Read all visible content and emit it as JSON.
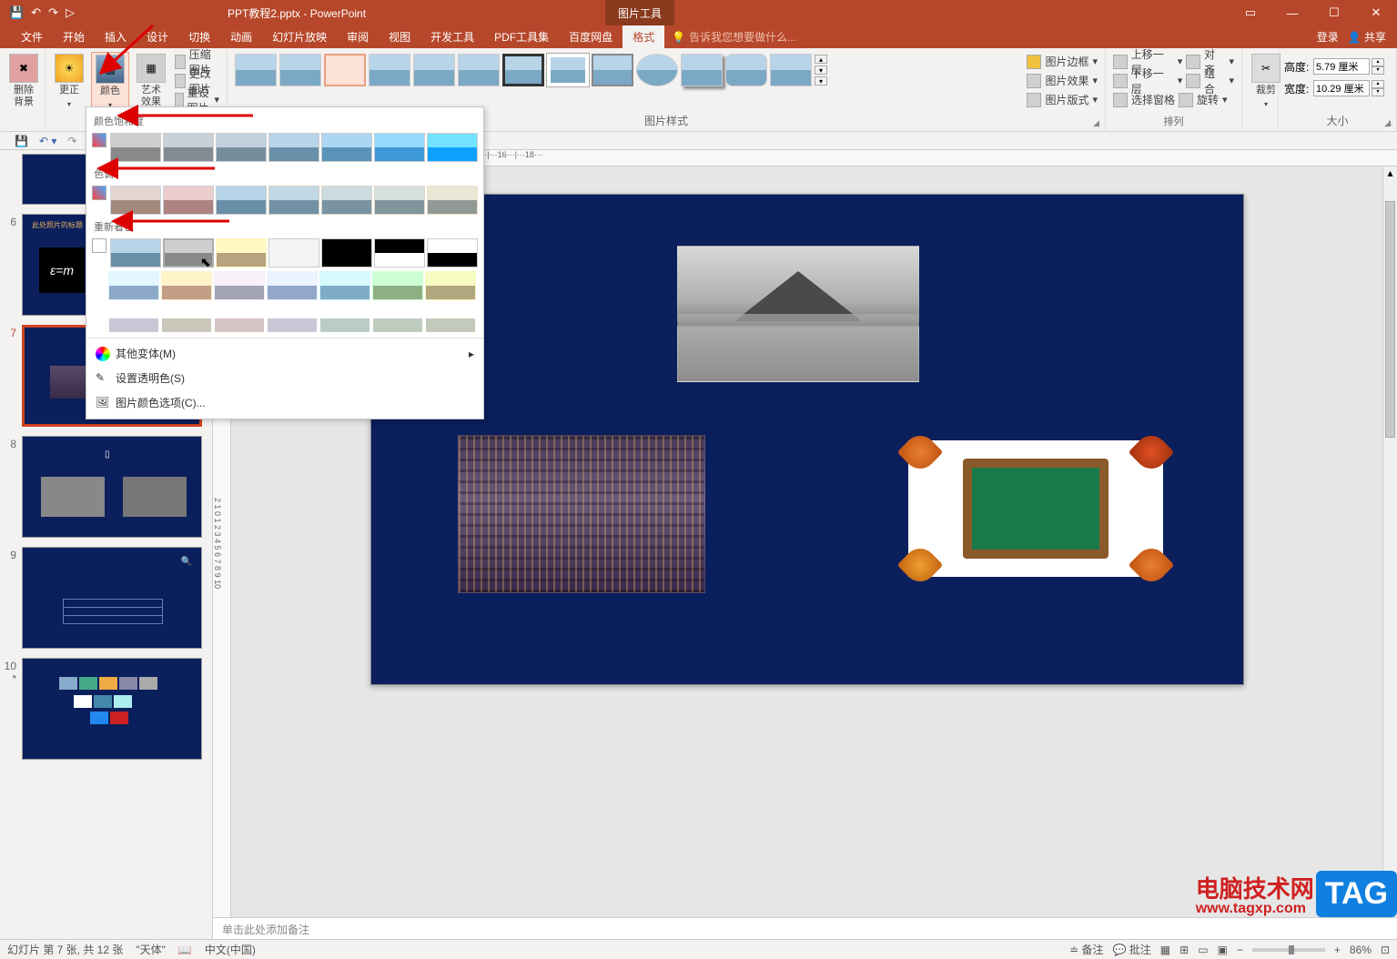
{
  "app": {
    "title": "PPT教程2.pptx - PowerPoint",
    "tooltab": "图片工具"
  },
  "win": {
    "login": "登录",
    "share": "共享"
  },
  "tabs": [
    "文件",
    "开始",
    "插入",
    "设计",
    "切换",
    "动画",
    "幻灯片放映",
    "审阅",
    "视图",
    "开发工具",
    "PDF工具集",
    "百度网盘",
    "格式"
  ],
  "tell": "告诉我您想要做什么...",
  "ribbon": {
    "removebg": "删除背景",
    "correct": "更正",
    "color": "颜色",
    "artfx": "艺术效果",
    "compress": "压缩图片",
    "change": "更改图片",
    "reset": "重设图片",
    "g_adjust": "",
    "g_styles": "图片样式",
    "border": "图片边框",
    "effects": "图片效果",
    "layout": "图片版式",
    "forward": "上移一层",
    "backward": "下移一层",
    "selpane": "选择窗格",
    "align": "对齐",
    "group": "组合",
    "rotate": "旋转",
    "g_arrange": "排列",
    "crop": "裁剪",
    "height_lbl": "高度:",
    "width_lbl": "宽度:",
    "height_val": "5.79 厘米",
    "width_val": "10.29 厘米",
    "g_size": "大小"
  },
  "dropdown": {
    "saturation": "颜色饱和度",
    "tone": "色调",
    "recolor": "重新着色",
    "more": "其他变体(M)",
    "transparent": "设置透明色(S)",
    "options": "图片颜色选项(C)..."
  },
  "thumbs": {
    "n6": "6",
    "tit6": "此处照片的标题",
    "n7": "7",
    "n8": "8",
    "n9": "9",
    "n10": "10",
    "star": "*"
  },
  "notes": "单击此处添加备注",
  "status": {
    "slide": "幻灯片 第 7 张, 共 12 张",
    "theme": "\"天体\"",
    "lang": "中文(中国)",
    "notesbtn": "备注",
    "commentsbtn": "批注",
    "zoom": "86%"
  },
  "watermark": {
    "line1": "电脑技术网",
    "url": "www.tagxp.com",
    "tag": "TAG"
  }
}
